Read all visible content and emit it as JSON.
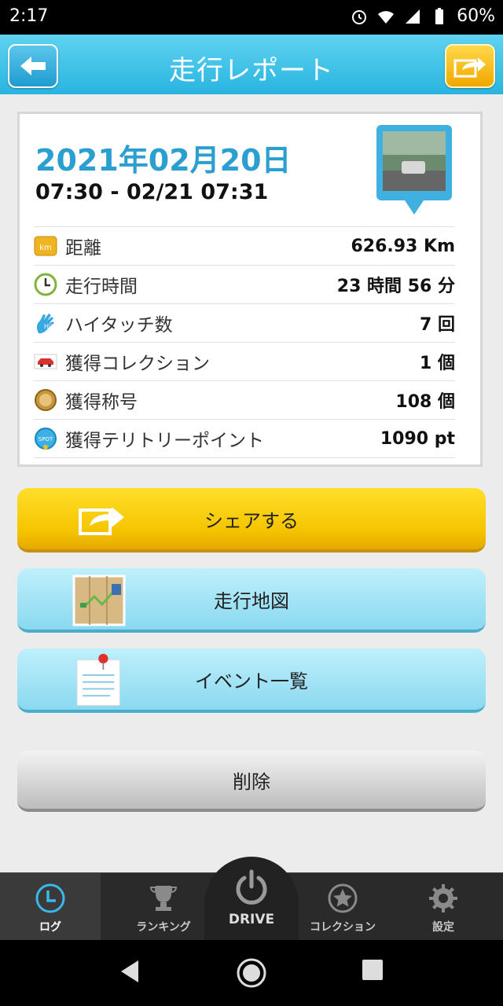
{
  "status": {
    "time": "2:17",
    "battery": "60%"
  },
  "header": {
    "title": "走行レポート",
    "back_icon": "back-arrow-icon",
    "share_icon": "share-icon"
  },
  "report": {
    "date": "2021年02月20日",
    "range": "07:30 - 02/21 07:31",
    "rows": [
      {
        "icon": "km-icon",
        "badge": "km",
        "label": "距離",
        "value": "626.93 Km"
      },
      {
        "icon": "clock-icon",
        "label": "走行時間",
        "value": "23 時間 56 分"
      },
      {
        "icon": "hi-five-icon",
        "badge": "Hi!",
        "label": "ハイタッチ数",
        "value": "7 回"
      },
      {
        "icon": "car-icon",
        "label": "獲得コレクション",
        "value": "1 個"
      },
      {
        "icon": "medal-icon",
        "label": "獲得称号",
        "value": "108 個"
      },
      {
        "icon": "spot-icon",
        "badge": "SPOT",
        "label": "獲得テリトリーポイント",
        "value": "1090 pt"
      }
    ]
  },
  "buttons": {
    "share": "シェアする",
    "map": "走行地図",
    "events": "イベント一覧",
    "delete": "削除"
  },
  "tabs": {
    "log": "ログ",
    "ranking": "ランキング",
    "drive": "DRIVE",
    "collection": "コレクション",
    "settings": "設定"
  },
  "colors": {
    "accent": "#29b4e0",
    "date": "#2a9fd0",
    "share_yellow": "#f5c400"
  }
}
